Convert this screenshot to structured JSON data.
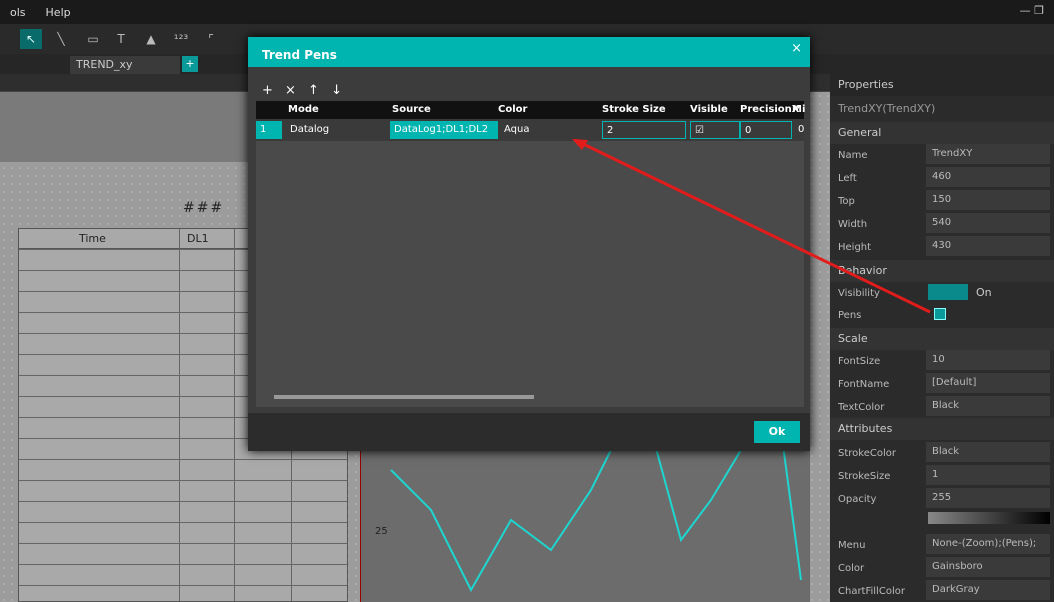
{
  "menu": {
    "tools": "ols",
    "help": "Help"
  },
  "tab": {
    "label": "TREND_xy",
    "add": "+"
  },
  "canvas": {
    "hash1": "###",
    "hash2": "#"
  },
  "table": {
    "col_time": "Time",
    "col_dl1": "DL1"
  },
  "chart": {
    "y_label": "25"
  },
  "dialog": {
    "title": "Trend Pens",
    "close": "×",
    "toolbar": "+ × ↑ ↓",
    "headers": {
      "mode": "Mode",
      "source": "Source",
      "color": "Color",
      "stroke": "Stroke Size",
      "visible": "Visible",
      "precisionx": "PrecisionX",
      "mi": "Mi"
    },
    "row": {
      "index": "1",
      "mode": "Datalog",
      "source": "DataLog1;DL1;DL2",
      "color": "Aqua",
      "stroke": "2",
      "visible": "☑",
      "precision": "0",
      "extra": "0"
    },
    "ok": "Ok"
  },
  "props": {
    "title": "Properties",
    "object": "TrendXY(TrendXY)",
    "general": "General",
    "name_l": "Name",
    "name_v": "TrendXY",
    "left_l": "Left",
    "left_v": "460",
    "top_l": "Top",
    "top_v": "150",
    "width_l": "Width",
    "width_v": "540",
    "height_l": "Height",
    "height_v": "430",
    "behavior": "Behavior",
    "visibility_l": "Visibility",
    "visibility_v": "On",
    "pens_l": "Pens",
    "scale": "Scale",
    "fontsize_l": "FontSize",
    "fontsize_v": "10",
    "fontname_l": "FontName",
    "fontname_v": "[Default]",
    "textcolor_l": "TextColor",
    "textcolor_v": "Black",
    "attributes": "Attributes",
    "strokecolor_l": "StrokeColor",
    "strokecolor_v": "Black",
    "strokesize_l": "StrokeSize",
    "strokesize_v": "1",
    "opacity_l": "Opacity",
    "opacity_v": "255",
    "menu_l": "Menu",
    "menu_v": "None-(Zoom);(Pens);(GraphM",
    "color_l": "Color",
    "color_v": "Gainsboro",
    "chartfill_l": "ChartFillColor",
    "chartfill_v": "DarkGray"
  }
}
